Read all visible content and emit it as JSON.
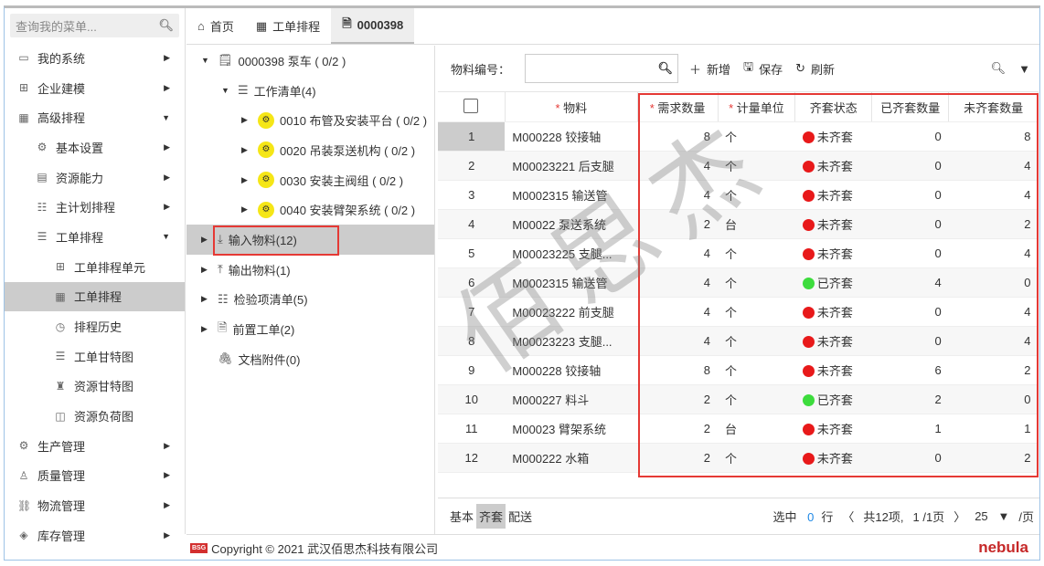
{
  "search": {
    "placeholder": "查询我的菜单..."
  },
  "sidebar": [
    {
      "label": "我的系统",
      "icon": "monitor-icon",
      "level": 1,
      "arrow": "▶"
    },
    {
      "label": "企业建模",
      "icon": "plus-square-icon",
      "level": 1,
      "arrow": "▶"
    },
    {
      "label": "高级排程",
      "icon": "calendar-icon",
      "level": 1,
      "arrow": "▼"
    },
    {
      "label": "基本设置",
      "icon": "gear-icon",
      "level": 2,
      "arrow": "▶"
    },
    {
      "label": "资源能力",
      "icon": "resource-icon",
      "level": 2,
      "arrow": "▶"
    },
    {
      "label": "主计划排程",
      "icon": "plan-icon",
      "level": 2,
      "arrow": "▶"
    },
    {
      "label": "工单排程",
      "icon": "schedule-icon",
      "level": 2,
      "arrow": "▼"
    },
    {
      "label": "工单排程单元",
      "icon": "grid-icon",
      "level": 3,
      "arrow": ""
    },
    {
      "label": "工单排程",
      "icon": "table-icon",
      "level": 3,
      "arrow": "",
      "active": true
    },
    {
      "label": "排程历史",
      "icon": "history-icon",
      "level": 3,
      "arrow": ""
    },
    {
      "label": "工单甘特图",
      "icon": "gantt-icon",
      "level": 3,
      "arrow": ""
    },
    {
      "label": "资源甘特图",
      "icon": "resource-gantt-icon",
      "level": 3,
      "arrow": ""
    },
    {
      "label": "资源负荷图",
      "icon": "load-chart-icon",
      "level": 3,
      "arrow": ""
    },
    {
      "label": "生产管理",
      "icon": "production-icon",
      "level": 1,
      "arrow": "▶"
    },
    {
      "label": "质量管理",
      "icon": "quality-icon",
      "level": 1,
      "arrow": "▶"
    },
    {
      "label": "物流管理",
      "icon": "logistics-icon",
      "level": 1,
      "arrow": "▶"
    },
    {
      "label": "库存管理",
      "icon": "inventory-icon",
      "level": 1,
      "arrow": "▶"
    }
  ],
  "tabs": [
    {
      "label": "首页",
      "icon": "home-icon"
    },
    {
      "label": "工单排程",
      "icon": "table-icon"
    },
    {
      "label": "0000398",
      "icon": "document-icon",
      "active": true
    }
  ],
  "tree": [
    {
      "label": "0000398 泵车 ( 0/2 )",
      "indent": 0,
      "toggle": "▼",
      "icon": "order-icon"
    },
    {
      "label": "工作清单(4)",
      "indent": 1,
      "toggle": "▼",
      "icon": "list-icon"
    },
    {
      "label": "0010 布管及安装平台 ( 0/2 )",
      "indent": 2,
      "toggle": "▶",
      "icon": "gear-badge-icon"
    },
    {
      "label": "0020 吊装泵送机构 ( 0/2 )",
      "indent": 2,
      "toggle": "▶",
      "icon": "gear-badge-icon"
    },
    {
      "label": "0030 安装主阀组 ( 0/2 )",
      "indent": 2,
      "toggle": "▶",
      "icon": "gear-badge-icon"
    },
    {
      "label": "0040 安装臂架系统 ( 0/2 )",
      "indent": 2,
      "toggle": "▶",
      "icon": "gear-badge-icon"
    },
    {
      "label": "输入物料(12)",
      "indent": 0,
      "toggle": "▶",
      "icon": "download-icon",
      "selected": true
    },
    {
      "label": "输出物料(1)",
      "indent": 0,
      "toggle": "▶",
      "icon": "upload-icon"
    },
    {
      "label": "检验项清单(5)",
      "indent": 0,
      "toggle": "▶",
      "icon": "checklist-icon"
    },
    {
      "label": "前置工单(2)",
      "indent": 0,
      "toggle": "▶",
      "icon": "document-icon"
    },
    {
      "label": "文档附件(0)",
      "indent": 0,
      "toggle": "",
      "icon": "paperclip-icon"
    }
  ],
  "toolbar": {
    "field_label": "物料编号：",
    "add": "新增",
    "save": "保存",
    "refresh": "刷新"
  },
  "table": {
    "columns": [
      {
        "label": "物料",
        "required": true
      },
      {
        "label": "需求数量",
        "required": true
      },
      {
        "label": "计量单位",
        "required": true
      },
      {
        "label": "齐套状态"
      },
      {
        "label": "已齐套数量"
      },
      {
        "label": "未齐套数量"
      }
    ],
    "rows": [
      [
        "1",
        "M000228 铰接轴",
        "8",
        "个",
        "未齐套",
        "0",
        "8"
      ],
      [
        "2",
        "M00023221 后支腿",
        "4",
        "个",
        "未齐套",
        "0",
        "4"
      ],
      [
        "3",
        "M0002315 输送管",
        "4",
        "个",
        "未齐套",
        "0",
        "4"
      ],
      [
        "4",
        "M00022 泵送系统",
        "2",
        "台",
        "未齐套",
        "0",
        "2"
      ],
      [
        "5",
        "M00023225 支腿...",
        "4",
        "个",
        "未齐套",
        "0",
        "4"
      ],
      [
        "6",
        "M0002315 输送管",
        "4",
        "个",
        "已齐套",
        "4",
        "0"
      ],
      [
        "7",
        "M00023222 前支腿",
        "4",
        "个",
        "未齐套",
        "0",
        "4"
      ],
      [
        "8",
        "M00023223 支腿...",
        "4",
        "个",
        "未齐套",
        "0",
        "4"
      ],
      [
        "9",
        "M000228 铰接轴",
        "8",
        "个",
        "未齐套",
        "6",
        "2"
      ],
      [
        "10",
        "M000227 料斗",
        "2",
        "个",
        "已齐套",
        "2",
        "0"
      ],
      [
        "11",
        "M00023 臂架系统",
        "2",
        "台",
        "未齐套",
        "1",
        "1"
      ],
      [
        "12",
        "M000222 水箱",
        "2",
        "个",
        "未齐套",
        "0",
        "2"
      ]
    ]
  },
  "status_colors": {
    "未齐套": "#e8191a",
    "已齐套": "#3ddc3d"
  },
  "pager": {
    "subtabs": [
      "基本",
      "齐套",
      "配送"
    ],
    "active_subtab": "齐套",
    "selected_label": "选中",
    "selected": "0",
    "row_label": "行",
    "total": "共12项,",
    "page": "1 /1页",
    "page_size": "25",
    "per_page": "/页"
  },
  "footer": {
    "copyright": "Copyright © 2021 武汉佰思杰科技有限公司",
    "logo_text": "BSG",
    "brand": "nebula"
  },
  "watermark": "佰思杰"
}
